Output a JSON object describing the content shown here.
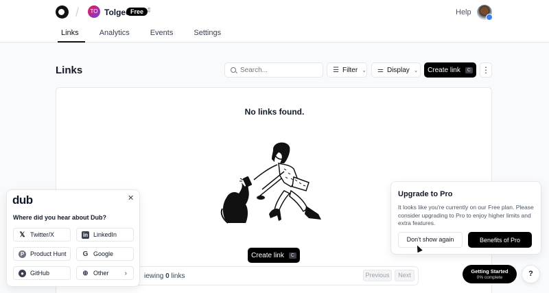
{
  "workspace": {
    "initials": "TO",
    "name": "Tolgee",
    "plan": "Free"
  },
  "header": {
    "help_label": "Help"
  },
  "tabs": [
    {
      "label": "Links",
      "active": true
    },
    {
      "label": "Analytics",
      "active": false
    },
    {
      "label": "Events",
      "active": false
    },
    {
      "label": "Settings",
      "active": false
    }
  ],
  "page": {
    "title": "Links"
  },
  "toolbar": {
    "search_placeholder": "Search...",
    "filter_label": "Filter",
    "display_label": "Display",
    "create_label": "Create link",
    "create_shortcut": "C"
  },
  "empty_state": {
    "title": "No links found.",
    "create_label": "Create link",
    "create_shortcut": "C"
  },
  "pagination": {
    "viewing_prefix": "iewing",
    "count": "0",
    "suffix": "links",
    "prev_label": "Previous",
    "next_label": "Next"
  },
  "survey": {
    "logo": "dub",
    "question": "Where did you hear about Dub?",
    "options": [
      {
        "label": "Twitter/X",
        "icon": "x-logo-icon"
      },
      {
        "label": "LinkedIn",
        "icon": "linkedin-icon"
      },
      {
        "label": "Product Hunt",
        "icon": "producthunt-icon"
      },
      {
        "label": "Google",
        "icon": "google-icon"
      },
      {
        "label": "GitHub",
        "icon": "github-icon"
      },
      {
        "label": "Other",
        "icon": "globe-icon"
      }
    ]
  },
  "upgrade": {
    "title": "Upgrade to Pro",
    "body": "It looks like you're currently on our Free plan. Please consider upgrading to Pro to enjoy higher limits and extra features.",
    "dismiss_label": "Don't show again",
    "cta_label": "Benefits of Pro"
  },
  "getting_started": {
    "title": "Getting Started",
    "progress_text": "0% complete",
    "progress": 0
  },
  "help_fab": {
    "label": "?"
  },
  "colors": {
    "primary": "#000000",
    "background": "#f9fafb",
    "border": "#e5e7eb",
    "accent_blue": "#3b82f6"
  }
}
